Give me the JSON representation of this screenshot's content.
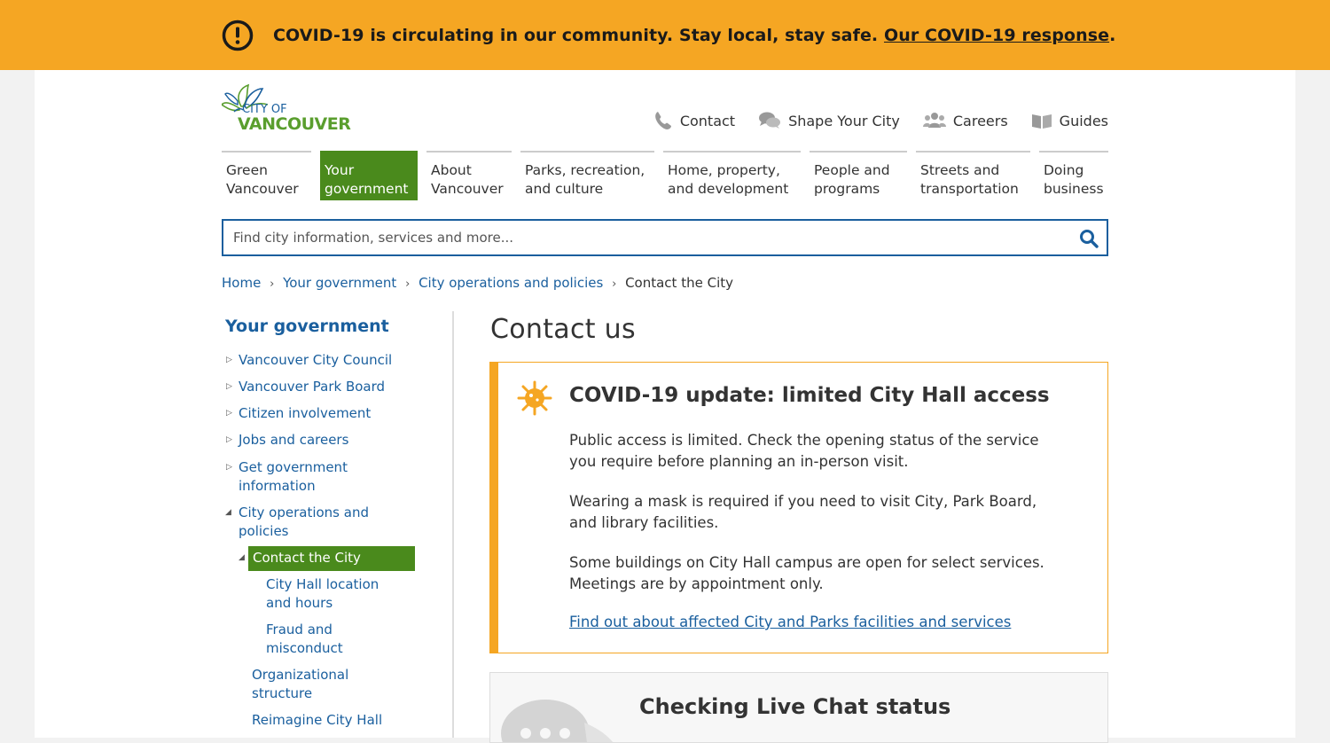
{
  "alert": {
    "text": "COVID-19 is circulating in our community. Stay local, stay safe.",
    "link": "Our COVID-19 response",
    "after": ".",
    "color": "#f5a623"
  },
  "logo": {
    "line1": "CITY OF",
    "line2": "VANCOUVER"
  },
  "utility_nav": [
    {
      "label": "Contact",
      "icon": "phone-icon"
    },
    {
      "label": "Shape Your City",
      "icon": "chat-bubbles-icon"
    },
    {
      "label": "Careers",
      "icon": "people-icon"
    },
    {
      "label": "Guides",
      "icon": "book-icon"
    }
  ],
  "main_nav": [
    {
      "line1": "Green",
      "line2": "Vancouver"
    },
    {
      "line1": "Your",
      "line2": "government",
      "active": true
    },
    {
      "line1": "About",
      "line2": "Vancouver"
    },
    {
      "line1": "Parks, recreation,",
      "line2": "and culture"
    },
    {
      "line1": "Home, property,",
      "line2": "and development"
    },
    {
      "line1": "People and",
      "line2": "programs"
    },
    {
      "line1": "Streets and",
      "line2": "transportation"
    },
    {
      "line1": "Doing",
      "line2": "business"
    }
  ],
  "search": {
    "placeholder": "Find city information, services and more..."
  },
  "breadcrumb": {
    "home": "Home",
    "level1": "Your government",
    "level2": "City operations and policies",
    "current": "Contact the City",
    "separator": "›"
  },
  "sidebar": {
    "title": "Your government",
    "items": {
      "council": "Vancouver City Council",
      "park_board": "Vancouver Park Board",
      "citizen": "Citizen involvement",
      "jobs": "Jobs and careers",
      "gov_info_1": "Get government",
      "gov_info_2": "information",
      "city_ops_1": "City operations and",
      "city_ops_2": "policies",
      "contact": "Contact the City",
      "city_hall_1": "City Hall location",
      "city_hall_2": "and hours",
      "fraud_1": "Fraud and",
      "fraud_2": "misconduct",
      "org_1": "Organizational",
      "org_2": "structure",
      "reimagine": "Reimagine City Hall"
    }
  },
  "content": {
    "title": "Contact us",
    "covid": {
      "heading": "COVID-19 update: limited City Hall access",
      "p1": "Public access is limited. Check the opening status of the service you require before planning an in-person visit.",
      "p2": "Wearing a mask is required if you need to visit City, Park Board, and library facilities.",
      "p3": "Some buildings on City Hall campus are open for select services. Meetings are by appointment only.",
      "link": "Find out about affected City and Parks facilities and services"
    },
    "chat": {
      "title": "Checking Live Chat status"
    }
  }
}
